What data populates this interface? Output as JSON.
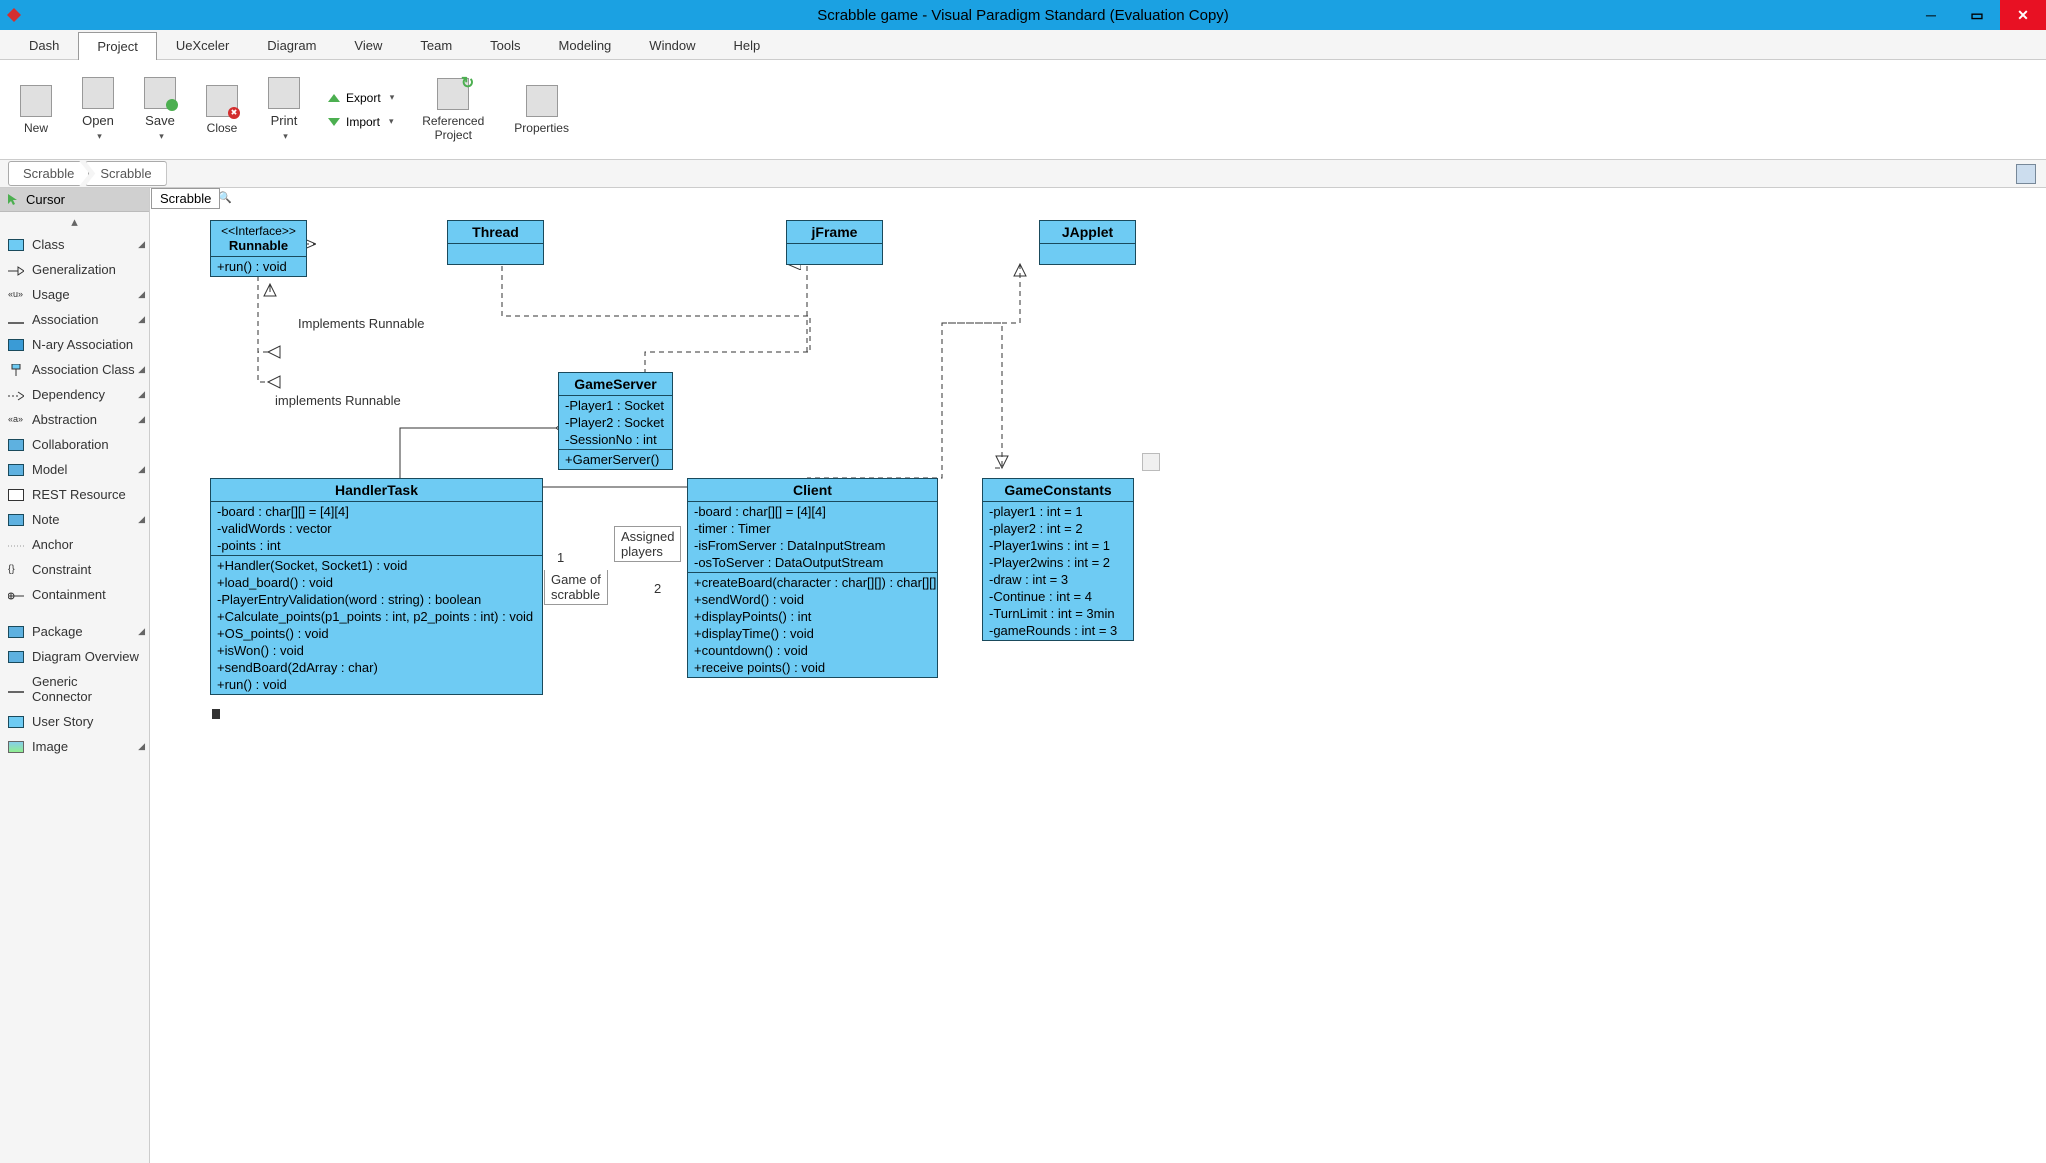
{
  "titlebar": {
    "title": "Scrabble game - Visual Paradigm Standard (Evaluation Copy)"
  },
  "menubar": {
    "items": [
      "Dash",
      "Project",
      "UeXceler",
      "Diagram",
      "View",
      "Team",
      "Tools",
      "Modeling",
      "Window",
      "Help"
    ],
    "activeIndex": 1
  },
  "ribbon": {
    "buttons": [
      {
        "label": "New",
        "dropdown": false
      },
      {
        "label": "Open",
        "dropdown": true
      },
      {
        "label": "Save",
        "dropdown": true
      },
      {
        "label": "Close",
        "dropdown": false
      },
      {
        "label": "Print",
        "dropdown": true
      }
    ],
    "export": "Export",
    "import": "Import",
    "referenced": "Referenced\nProject",
    "properties": "Properties"
  },
  "breadcrumb": {
    "items": [
      "Scrabble",
      "Scrabble"
    ]
  },
  "toolbox": {
    "cursor": "Cursor",
    "items": [
      {
        "label": "Class",
        "icon": "#6ecbf3",
        "arrow": true
      },
      {
        "label": "Generalization",
        "icon": "arrow-gen",
        "arrow": false
      },
      {
        "label": "Usage",
        "icon": "usage",
        "arrow": true
      },
      {
        "label": "Association",
        "icon": "line",
        "arrow": true
      },
      {
        "label": "N-ary Association",
        "icon": "#3a9bd6",
        "arrow": false
      },
      {
        "label": "Association Class",
        "icon": "assoc-class",
        "arrow": true
      },
      {
        "label": "Dependency",
        "icon": "dep",
        "arrow": true
      },
      {
        "label": "Abstraction",
        "icon": "abs",
        "arrow": true
      },
      {
        "label": "Collaboration",
        "icon": "#5eb1e0",
        "arrow": false
      },
      {
        "label": "Model",
        "icon": "#5eb1e0",
        "arrow": true
      },
      {
        "label": "REST Resource",
        "icon": "rest",
        "arrow": false
      },
      {
        "label": "Note",
        "icon": "#5eb1e0",
        "arrow": true
      },
      {
        "label": "Anchor",
        "icon": "anchor",
        "arrow": false
      },
      {
        "label": "Constraint",
        "icon": "constraint",
        "arrow": false
      },
      {
        "label": "Containment",
        "icon": "contain",
        "arrow": false
      },
      {
        "label": "Package",
        "icon": "#5eb1e0",
        "arrow": true,
        "gap": true
      },
      {
        "label": "Diagram Overview",
        "icon": "#5eb1e0",
        "arrow": false
      },
      {
        "label": "Generic Connector",
        "icon": "line",
        "arrow": false
      },
      {
        "label": "User Story",
        "icon": "#6ecbf3",
        "arrow": false
      },
      {
        "label": "Image",
        "icon": "img",
        "arrow": true
      }
    ]
  },
  "canvas": {
    "tab": "Scrabble",
    "classes": {
      "runnable": {
        "stereotype": "<<Interface>>",
        "name": "Runnable",
        "ops": [
          "+run() : void"
        ]
      },
      "thread": {
        "name": "Thread"
      },
      "jframe": {
        "name": "jFrame"
      },
      "japplet": {
        "name": "JApplet"
      },
      "gameserver": {
        "name": "GameServer",
        "attrs": [
          "-Player1 : Socket",
          "-Player2 : Socket",
          "-SessionNo : int"
        ],
        "ops": [
          "+GamerServer()"
        ]
      },
      "handlertask": {
        "name": "HandlerTask",
        "attrs": [
          "-board : char[][] = [4][4]",
          "-validWords : vector",
          "-points : int"
        ],
        "ops": [
          "+Handler(Socket, Socket1) : void",
          "+load_board() : void",
          "-PlayerEntryValidation(word : string) : boolean",
          "+Calculate_points(p1_points : int, p2_points : int) : void",
          "+OS_points() : void",
          "+isWon() : void",
          "+sendBoard(2dArray : char)",
          "+run() : void"
        ]
      },
      "client": {
        "name": "Client",
        "attrs": [
          "-board : char[][] = [4][4]",
          "-timer : Timer",
          "-isFromServer : DataInputStream",
          "-osToServer : DataOutputStream"
        ],
        "ops": [
          "+createBoard(character : char[][]) : char[][]",
          "+sendWord() : void",
          "+displayPoints() : int",
          "+displayTime() : void",
          "+countdown() : void",
          "+receive points() : void"
        ]
      },
      "gameconstants": {
        "name": "GameConstants",
        "attrs": [
          "-player1 : int = 1",
          "-player2 : int = 2",
          "-Player1wins : int = 1",
          "-Player2wins : int = 2",
          "-draw : int = 3",
          "-Continue : int = 4",
          "-TurnLimit : int = 3min",
          "-gameRounds : int = 3"
        ]
      }
    },
    "labels": {
      "implRunnable1": "Implements Runnable",
      "implRunnable2": "implements Runnable",
      "assigned": "Assigned\nplayers",
      "gameof": "Game of\nscrabble",
      "m1": "1",
      "m2": "2"
    }
  }
}
